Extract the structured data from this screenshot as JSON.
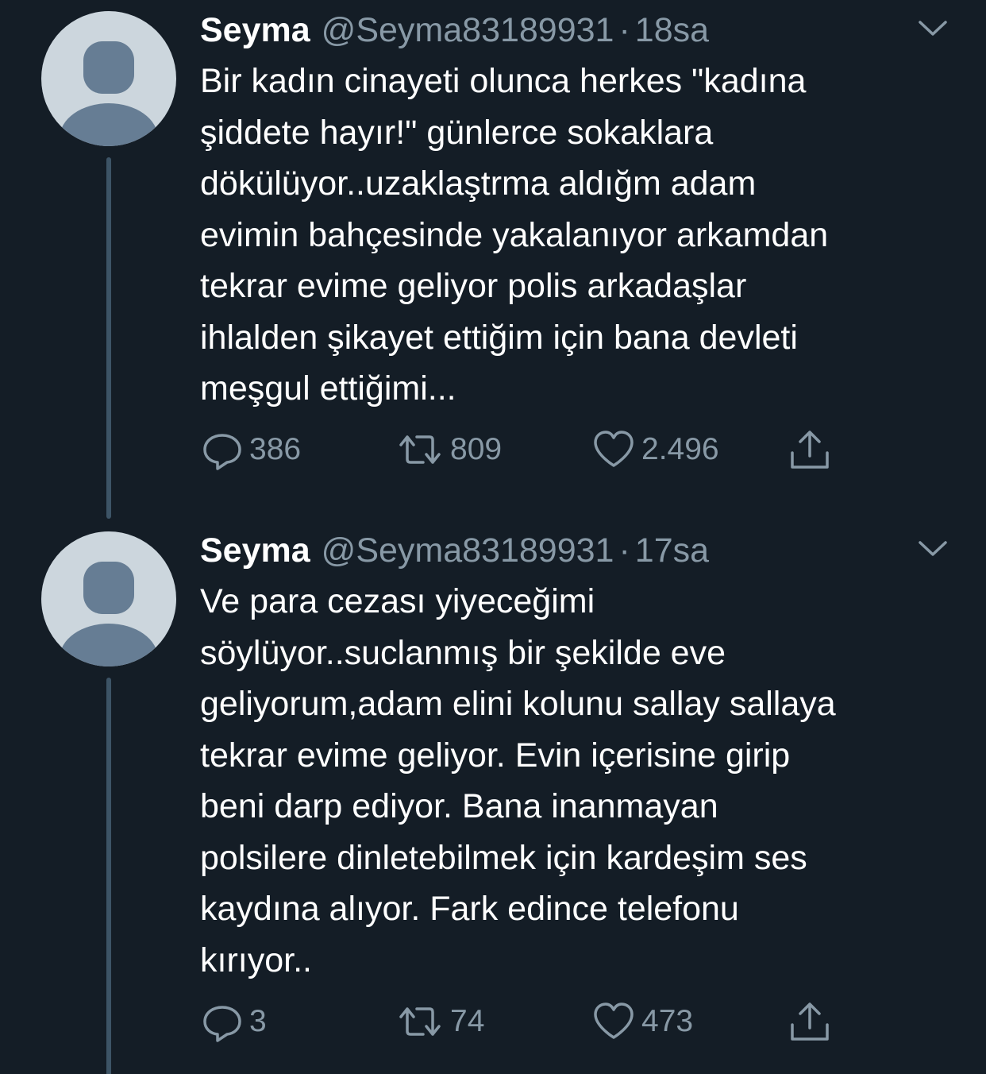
{
  "colors": {
    "background": "#141d26",
    "text": "#ffffff",
    "secondary": "#8899a6",
    "thread_line": "#3d5466",
    "avatar_bg": "#ccd6dd",
    "avatar_fg": "#667d94"
  },
  "tweets": [
    {
      "name": "Seyma",
      "handle": "@Seyma83189931",
      "separator": "·",
      "time": "18sa",
      "text": "Bir kadın cinayeti olunca herkes \"kadına\nşiddete hayır!\" günlerce sokaklara\ndökülüyor..uzaklaştrma aldığm adam\nevimin bahçesinde yakalanıyor arkamdan\ntekrar evime geliyor polis arkadaşlar\nihlalden şikayet ettiğim için bana  devleti\nmeşgul ettiğimi...",
      "replies": "386",
      "retweets": "809",
      "likes": "2.496",
      "icons": [
        "avatar-placeholder-icon",
        "chevron-down-icon",
        "reply-icon",
        "retweet-icon",
        "like-icon",
        "share-icon"
      ]
    },
    {
      "name": "Seyma",
      "handle": "@Seyma83189931",
      "separator": "·",
      "time": "17sa",
      "text": "Ve para cezası yiyeceğimi\nsöylüyor..suclanmış bir şekilde eve\ngeliyorum,adam elini kolunu sallay sallaya\ntekrar evime geliyor. Evin içerisine girip\nbeni darp ediyor. Bana inanmayan\npolsilere dinletebilmek için kardeşim ses\nkaydına alıyor. Fark edince telefonu\nkırıyor..",
      "replies": "3",
      "retweets": "74",
      "likes": "473",
      "icons": [
        "avatar-placeholder-icon",
        "chevron-down-icon",
        "reply-icon",
        "retweet-icon",
        "like-icon",
        "share-icon"
      ]
    }
  ]
}
